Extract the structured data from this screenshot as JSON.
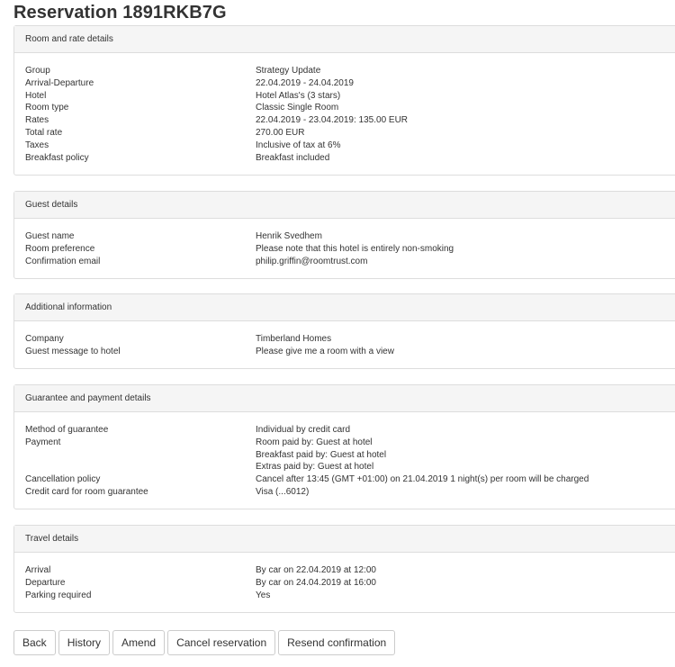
{
  "title": "Reservation 1891RKB7G",
  "room_rate": {
    "heading": "Room and rate details",
    "rows": [
      {
        "label": "Group",
        "value": "Strategy Update"
      },
      {
        "label": "Arrival-Departure",
        "value": "22.04.2019 - 24.04.2019"
      },
      {
        "label": "Hotel",
        "value": "Hotel Atlas's (3 stars)"
      },
      {
        "label": "Room type",
        "value": "Classic Single Room"
      },
      {
        "label": "Rates",
        "value": "22.04.2019 - 23.04.2019: 135.00 EUR"
      },
      {
        "label": "Total rate",
        "value": "270.00 EUR"
      },
      {
        "label": "Taxes",
        "value": "Inclusive of tax at 6%"
      },
      {
        "label": "Breakfast policy",
        "value": "Breakfast included"
      }
    ]
  },
  "guest": {
    "heading": "Guest details",
    "rows": [
      {
        "label": "Guest name",
        "value": "Henrik Svedhem"
      },
      {
        "label": "Room preference",
        "value": "Please note that this hotel is entirely non-smoking"
      },
      {
        "label": "Confirmation email",
        "value": "philip.griffin@roomtrust.com"
      }
    ]
  },
  "additional": {
    "heading": "Additional information",
    "rows": [
      {
        "label": "Company",
        "value": "Timberland Homes"
      },
      {
        "label": "Guest message to hotel",
        "value": "Please give me a room with a view"
      }
    ]
  },
  "guarantee": {
    "heading": "Guarantee and payment details",
    "method_label": "Method of guarantee",
    "method_value": "Individual by credit card",
    "payment_label": "Payment",
    "payment_lines": [
      "Room paid by: Guest at hotel",
      "Breakfast paid by: Guest at hotel",
      "Extras paid by: Guest at hotel"
    ],
    "cancel_label": "Cancellation policy",
    "cancel_value": "Cancel after 13:45 (GMT +01:00) on 21.04.2019 1 night(s) per room will be charged",
    "card_label": "Credit card for room guarantee",
    "card_value": "Visa (...6012)"
  },
  "travel": {
    "heading": "Travel details",
    "rows": [
      {
        "label": "Arrival",
        "value": "By car on 22.04.2019 at 12:00"
      },
      {
        "label": "Departure",
        "value": "By car on 24.04.2019 at 16:00"
      },
      {
        "label": "Parking required",
        "value": "Yes"
      }
    ]
  },
  "buttons": {
    "back": "Back",
    "history": "History",
    "amend": "Amend",
    "cancel": "Cancel reservation",
    "resend": "Resend confirmation"
  }
}
